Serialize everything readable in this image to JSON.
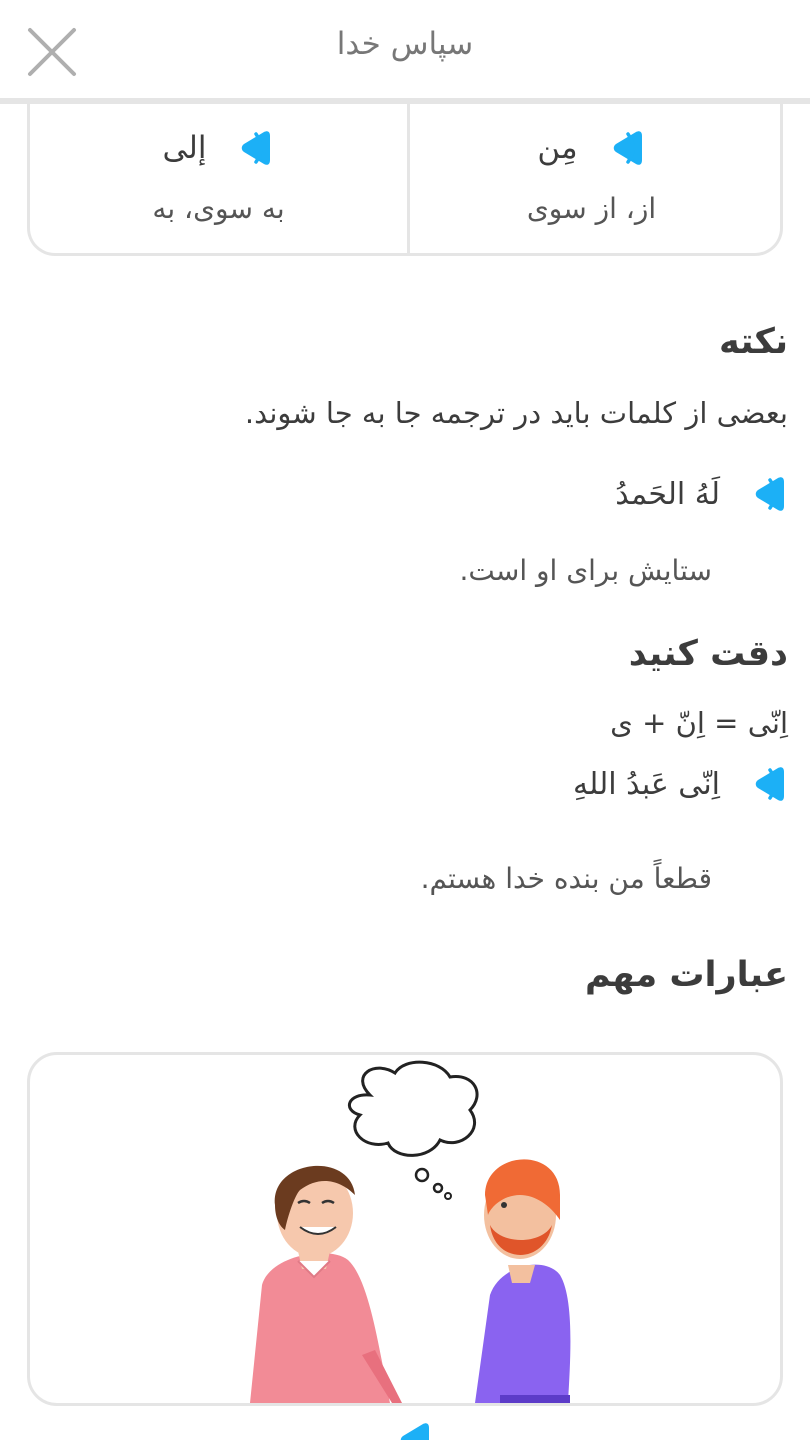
{
  "header": {
    "title": "سپاس خدا"
  },
  "words": [
    {
      "arabic": "مِن",
      "translation": "از، از سوی"
    },
    {
      "arabic": "إلى",
      "translation": "به سوی، به"
    }
  ],
  "note": {
    "heading": "نکته",
    "body": "بعضی از کلمات باید در ترجمه جا به جا شوند.",
    "example_arabic": "لَهُ الحَمدُ",
    "example_translation": "ستایش برای او است."
  },
  "attention": {
    "heading": "دقت کنید",
    "body": "اِنّی = اِنّ + ی",
    "example_arabic": "اِنّی عَبدُ اللهِ",
    "example_translation": "قطعاً من بنده خدا هستم."
  },
  "phrases": {
    "heading": "عبارات مهم"
  },
  "colors": {
    "accent": "#1cb0f6",
    "border": "#e5e5e5",
    "text": "#3c3c3c"
  }
}
